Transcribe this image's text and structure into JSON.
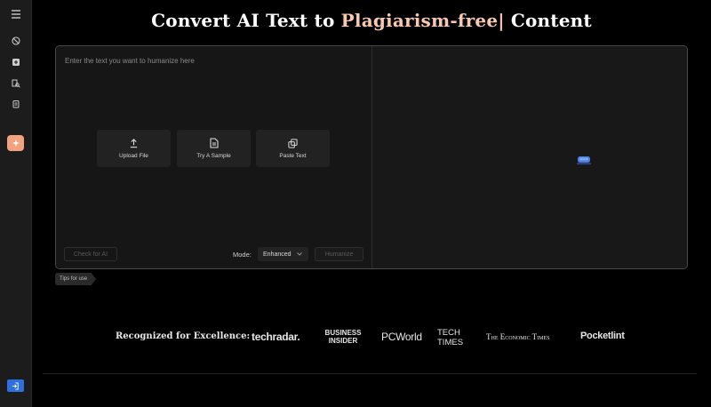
{
  "header": {
    "title_prefix": "Convert AI Text to ",
    "title_highlight": "Plagiarism-free|",
    "title_suffix": " Content"
  },
  "sidebar": {
    "items": [
      {
        "icon": "menu-icon"
      },
      {
        "icon": "ban-icon"
      },
      {
        "icon": "plus-square-icon"
      },
      {
        "icon": "search-doc-icon"
      },
      {
        "icon": "clipboard-icon"
      },
      {
        "icon": "sparkle-icon",
        "active": true
      },
      {
        "icon": "login-icon"
      }
    ]
  },
  "editor": {
    "placeholder": "Enter the text you want to humanize here",
    "actions": [
      {
        "label": "Upload File",
        "icon": "upload-icon"
      },
      {
        "label": "Try A Sample",
        "icon": "document-icon"
      },
      {
        "label": "Paste Text",
        "icon": "copy-icon"
      }
    ],
    "check_ai_label": "Check for AI",
    "mode_label": "Mode:",
    "mode_value": "Enhanced",
    "humanize_label": "Humanize"
  },
  "tips_label": "Tips for use",
  "recognition": {
    "heading": "Recognized for Excellence:",
    "logos": [
      "techradar.",
      "BUSINESS INSIDER",
      "PCWorld",
      "TECH TIMES",
      "The Economic Times",
      "Pocketlint"
    ]
  },
  "colors": {
    "accent": "#f3a27f",
    "highlight": "#f7c9b0",
    "login_blue": "#2f6fe0",
    "background": "#000000"
  }
}
